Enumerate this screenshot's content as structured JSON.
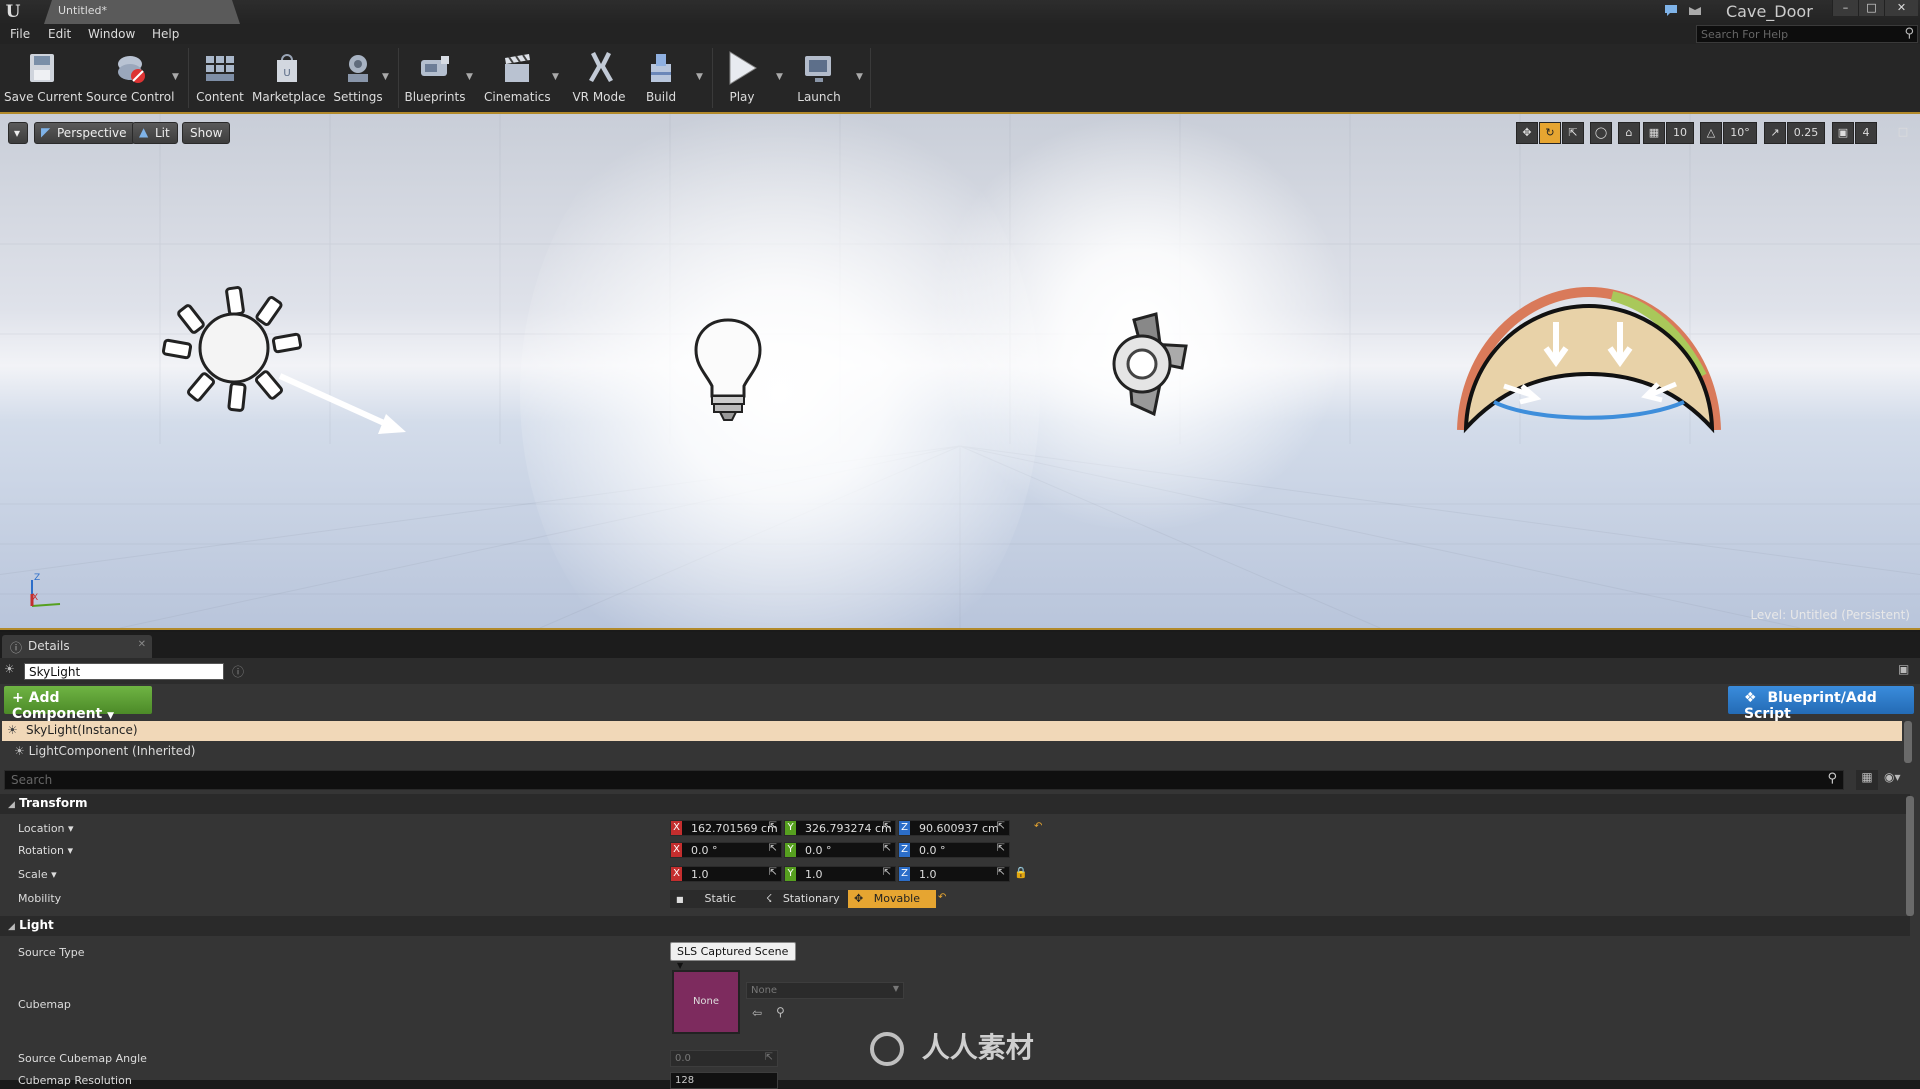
{
  "window": {
    "tab_title": "Untitled*",
    "project_name": "Cave_Door",
    "minimize": "–",
    "maximize": "□",
    "close": "✕"
  },
  "menu": {
    "items": [
      "File",
      "Edit",
      "Window",
      "Help"
    ],
    "help_search_placeholder": "Search For Help"
  },
  "toolbar": {
    "tools": [
      "Save Current",
      "Source Control",
      "Content",
      "Marketplace",
      "Settings",
      "Blueprints",
      "Cinematics",
      "VR Mode",
      "Build",
      "Play",
      "Launch"
    ]
  },
  "viewport": {
    "menu_arrow": "▾",
    "perspective": "Perspective",
    "lit": "Lit",
    "show": "Show",
    "grid_snap": "10",
    "rotation_snap": "10°",
    "scale_snap": "0.25",
    "camera_speed": "4",
    "level_label": "Level:",
    "level_name": "Untitled (Persistent)"
  },
  "details": {
    "tab_label": "Details",
    "actor_name": "SkyLight",
    "add_component": "+ Add Component",
    "blueprint_button": "Blueprint/Add Script",
    "component_instance": "SkyLight(Instance)",
    "component_inherited": "LightComponent (Inherited)",
    "search_placeholder": "Search",
    "transform": {
      "header": "Transform",
      "location_label": "Location",
      "rotation_label": "Rotation",
      "scale_label": "Scale",
      "mobility_label": "Mobility",
      "location": [
        "162.701569 cm",
        "326.793274 cm",
        "90.600937 cm"
      ],
      "rotation": [
        "0.0 °",
        "0.0 °",
        "0.0 °"
      ],
      "scale": [
        "1.0",
        "1.0",
        "1.0"
      ],
      "mobility_options": [
        "Static",
        "Stationary",
        "Movable"
      ],
      "mobility_selected": "Movable"
    },
    "light": {
      "header": "Light",
      "source_type_label": "Source Type",
      "source_type_value": "SLS Captured Scene",
      "cubemap_label": "Cubemap",
      "cubemap_thumb": "None",
      "cubemap_value": "None",
      "cubemap_angle_label": "Source Cubemap Angle",
      "cubemap_angle_value": "0.0",
      "cubemap_res_label": "Cubemap Resolution",
      "cubemap_res_value": "128"
    }
  },
  "watermark": "人人素材",
  "colors": {
    "accent_orange": "#b28a2b",
    "add_component_green": "#5c9e32",
    "blueprint_blue": "#2f7dcc",
    "movable_orange": "#e6a531",
    "selected_row": "#f1d8b8"
  }
}
